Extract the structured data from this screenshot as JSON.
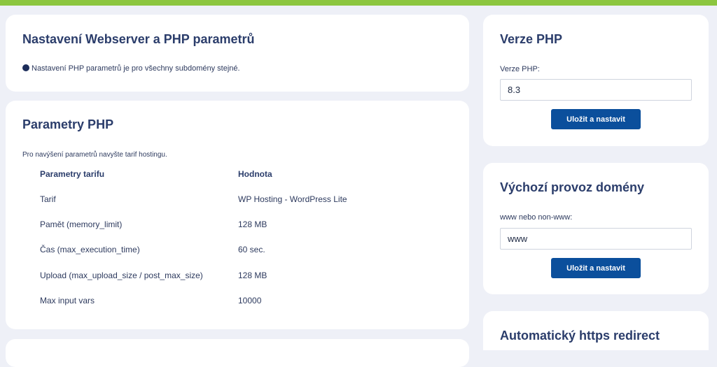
{
  "webserver": {
    "title": "Nastavení Webserver a PHP parametrů",
    "note": "Nastavení PHP parametrů je pro všechny subdomény stejné."
  },
  "php_params": {
    "title": "Parametry PHP",
    "note": "Pro navýšení parametrů navyšte tarif hostingu.",
    "columns": [
      "Parametry tarifu",
      "Hodnota"
    ],
    "rows": [
      {
        "name": "Tarif",
        "value": "WP Hosting - WordPress Lite"
      },
      {
        "name": "Pamět (memory_limit)",
        "value": "128 MB"
      },
      {
        "name": "Čas (max_execution_time)",
        "value": "60 sec."
      },
      {
        "name": "Upload (max_upload_size / post_max_size)",
        "value": "128 MB"
      },
      {
        "name": "Max input vars",
        "value": "10000"
      }
    ]
  },
  "php_version": {
    "title": "Verze PHP",
    "label": "Verze PHP:",
    "value": "8.3",
    "button": "Uložit a nastavit"
  },
  "default_domain": {
    "title": "Výchozí provoz domény",
    "label": "www nebo non-www:",
    "value": "www",
    "button": "Uložit a nastavit"
  },
  "https_redirect": {
    "title": "Automatický https redirect"
  },
  "colors": {
    "accent_bar": "#8cc63f",
    "button": "#0b4f9c",
    "title": "#2b3d6b",
    "background": "#eef0f7"
  }
}
